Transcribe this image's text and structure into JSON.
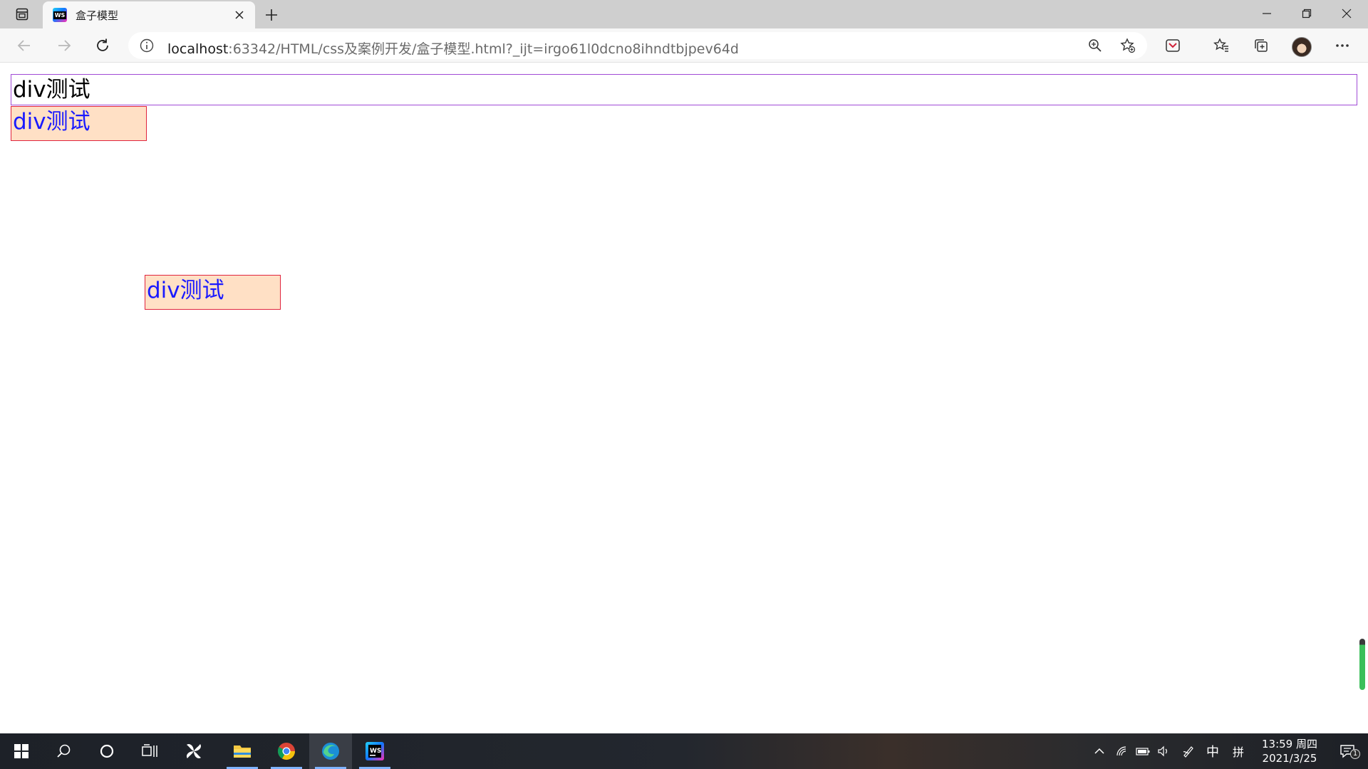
{
  "browser": {
    "tab": {
      "title": "盒子模型",
      "favicon_text": "WS"
    },
    "address": {
      "host": "localhost",
      "rest": ":63342/HTML/css及案例开发/盒子模型.html?_ijt=irgo61l0dcno8ihndtbjpev64d"
    }
  },
  "page": {
    "box1_text": "div测试",
    "box2_text": "div测试",
    "box3_text": "div测试"
  },
  "taskbar": {
    "tray_ime": "中",
    "tray_ime2": "拼",
    "time": "13:59 周四",
    "date": "2021/3/25",
    "notification_count": "1"
  },
  "colors": {
    "box1_border": "#a04bd6",
    "box_border": "#e0243e",
    "box_bg": "#ffe0c5",
    "box_text": "#1a1aff"
  }
}
